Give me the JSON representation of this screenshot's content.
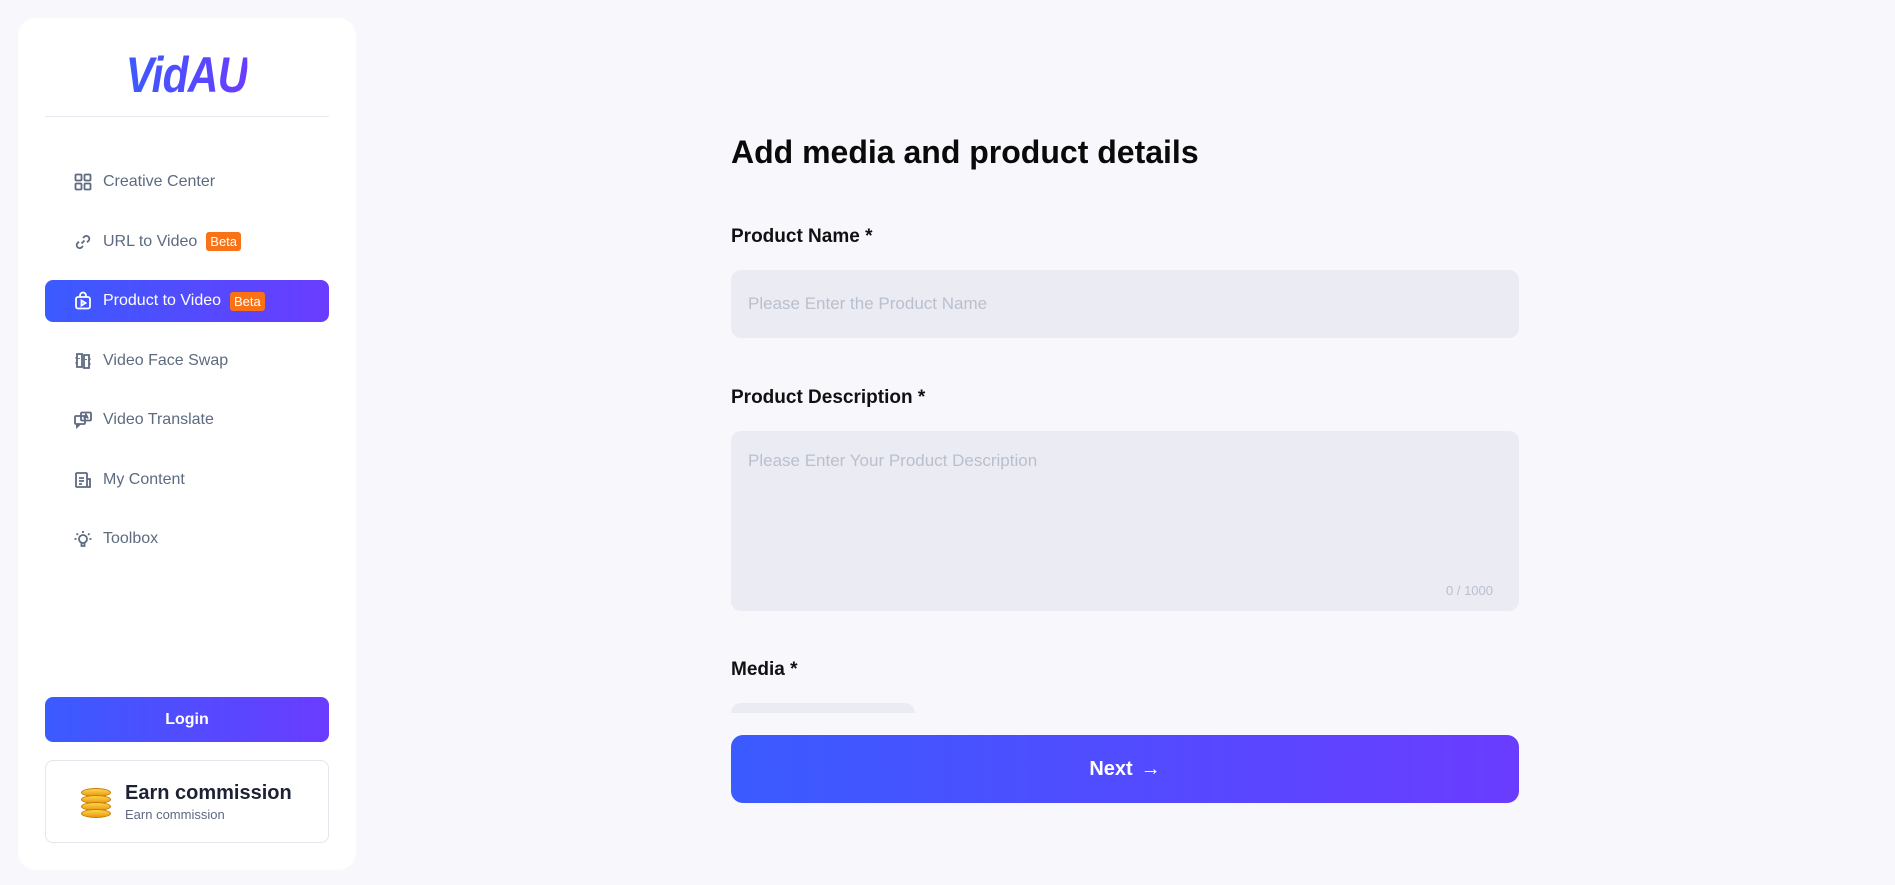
{
  "app": {
    "logo_text": "VidAU"
  },
  "sidebar": {
    "items": [
      {
        "label": "Creative Center",
        "icon": "grid-icon",
        "badge": null,
        "active": false
      },
      {
        "label": "URL to Video",
        "icon": "link-icon",
        "badge": "Beta",
        "active": false
      },
      {
        "label": "Product to Video",
        "icon": "shopping-bag-play-icon",
        "badge": "Beta",
        "active": true
      },
      {
        "label": "Video Face Swap",
        "icon": "face-swap-icon",
        "badge": null,
        "active": false
      },
      {
        "label": "Video Translate",
        "icon": "translate-icon",
        "badge": null,
        "active": false
      },
      {
        "label": "My Content",
        "icon": "document-icon",
        "badge": null,
        "active": false
      },
      {
        "label": "Toolbox",
        "icon": "lightbulb-icon",
        "badge": null,
        "active": false
      }
    ],
    "login_label": "Login",
    "earn": {
      "title": "Earn commission",
      "subtitle": "Earn commission",
      "icon": "coins-icon"
    }
  },
  "main": {
    "title": "Add media and product details",
    "product_name": {
      "label": "Product Name *",
      "value": "",
      "placeholder": "Please Enter the Product Name"
    },
    "product_description": {
      "label": "Product Description *",
      "value": "",
      "placeholder": "Please Enter Your Product Description",
      "counter": "0 / 1000"
    },
    "media": {
      "label": "Media *"
    },
    "next_label": "Next",
    "next_icon": "→"
  },
  "colors": {
    "accent_start": "#3a5bff",
    "accent_end": "#6a3cff",
    "badge": "#f97316",
    "background": "#f7f7fc"
  }
}
